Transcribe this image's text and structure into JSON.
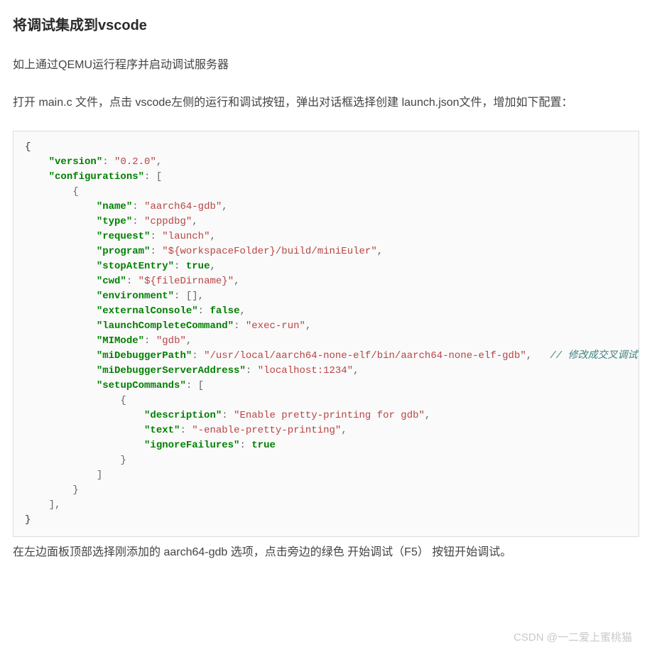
{
  "heading": "将调试集成到vscode",
  "para1": "如上通过QEMU运行程序并启动调试服务器",
  "para2": "打开 main.c 文件，点击 vscode左侧的运行和调试按钮，弹出对话框选择创建 launch.json文件，增加如下配置：",
  "para3": "在左边面板顶部选择刚添加的 aarch64-gdb 选项，点击旁边的绿色 开始调试（F5） 按钮开始调试。",
  "watermark": "CSDN @一二爱上蜜桃猫",
  "code": {
    "version": "0.2.0",
    "configurations_key": "configurations",
    "cfg": {
      "name": "aarch64-gdb",
      "type": "cppdbg",
      "request": "launch",
      "program": "${workspaceFolder}/build/miniEuler",
      "stopAtEntry": "true",
      "cwd": "${fileDirname}",
      "environment_val": "[]",
      "externalConsole": "false",
      "launchCompleteCommand": "exec-run",
      "MIMode": "gdb",
      "miDebuggerPath": "/usr/local/aarch64-none-elf/bin/aarch64-none-elf-gdb",
      "miDebuggerPath_comment": "// 修改成交叉调试器",
      "miDebuggerServerAddress": "localhost:1234",
      "setupCommands_key": "setupCommands",
      "sc": {
        "description": "Enable pretty-printing for gdb",
        "text": "-enable-pretty-printing",
        "ignoreFailures": "true"
      }
    }
  }
}
